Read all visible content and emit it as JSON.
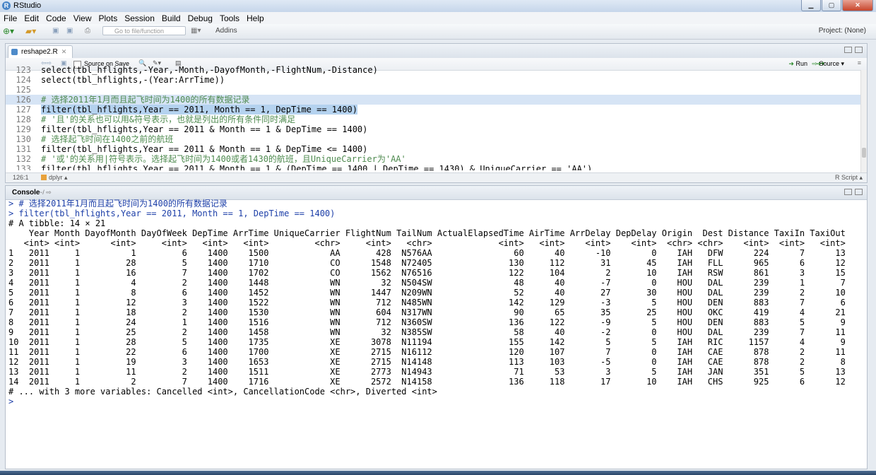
{
  "window": {
    "title": "RStudio"
  },
  "menu": [
    "File",
    "Edit",
    "Code",
    "View",
    "Plots",
    "Session",
    "Build",
    "Debug",
    "Tools",
    "Help"
  ],
  "toolbar": {
    "goto_placeholder": "Go to file/function",
    "addins": "Addins",
    "project": "Project: (None)"
  },
  "editor": {
    "tab_label": "reshape2.R",
    "source_on_save": "Source on Save",
    "run_label": "Run",
    "source_label": "Source",
    "cursor_pos": "126:1",
    "function_name": "dplyr",
    "file_type": "R Script",
    "lines": [
      {
        "n": "123",
        "text": "select(tbl_hflights,-Year,-Month,-DayofMonth,-FlightNum,-Distance)"
      },
      {
        "n": "124",
        "text": "select(tbl_hflights,-(Year:ArrTime))"
      },
      {
        "n": "125",
        "text": ""
      },
      {
        "n": "126",
        "text": "# 选择2011年1月而且起飞时间为1400的所有数据记录"
      },
      {
        "n": "127",
        "text": "filter(tbl_hflights,Year == 2011, Month == 1, DepTime == 1400)"
      },
      {
        "n": "128",
        "text": "# '且'的关系也可以用&符号表示，也就是列出的所有条件同时满足"
      },
      {
        "n": "129",
        "text": "filter(tbl_hflights,Year == 2011 & Month == 1 & DepTime == 1400)"
      },
      {
        "n": "130",
        "text": "# 选择起飞时间在1400之前的航班"
      },
      {
        "n": "131",
        "text": "filter(tbl_hflights,Year == 2011 & Month == 1 & DepTime <= 1400)"
      },
      {
        "n": "132",
        "text": "# '或'的关系用|符号表示。选择起飞时间为1400或者1430的航班，且UniqueCarrier为'AA'"
      },
      {
        "n": "133",
        "text": "filter(tbl_hflights,Year == 2011 & Month == 1 & (DepTime == 1400 | DepTime == 1430) & UniqueCarrier == 'AA')"
      }
    ]
  },
  "console": {
    "title": "Console",
    "path": "~/",
    "lines": [
      "> # 选择2011年1月而且起飞时间为1400的所有数据记录",
      "> filter(tbl_hflights,Year == 2011, Month == 1, DepTime == 1400)",
      "# A tibble: 14 × 21",
      "    Year Month DayofMonth DayOfWeek DepTime ArrTime UniqueCarrier FlightNum TailNum ActualElapsedTime AirTime ArrDelay DepDelay Origin  Dest Distance TaxiIn TaxiOut",
      "   <int> <int>      <int>     <int>   <int>   <int>         <chr>     <int>   <chr>             <int>   <int>    <int>    <int>  <chr> <chr>    <int>  <int>   <int>",
      "1   2011     1          1         6    1400    1500            AA       428  N576AA                60      40      -10        0    IAH   DFW      224      7      13",
      "2   2011     1         28         5    1400    1710            CO      1548  N72405               130     112       31       45    IAH   FLL      965      6      12",
      "3   2011     1         16         7    1400    1702            CO      1562  N76516               122     104        2       10    IAH   RSW      861      3      15",
      "4   2011     1          4         2    1400    1448            WN        32  N504SW                48      40       -7        0    HOU   DAL      239      1       7",
      "5   2011     1          8         6    1400    1452            WN      1447  N209WN                52      40       27       30    HOU   DAL      239      2      10",
      "6   2011     1         12         3    1400    1522            WN       712  N485WN               142     129       -3        5    HOU   DEN      883      7       6",
      "7   2011     1         18         2    1400    1530            WN       604  N317WN                90      65       35       25    HOU   OKC      419      4      21",
      "8   2011     1         24         1    1400    1516            WN       712  N360SW               136     122       -9        5    HOU   DEN      883      5       9",
      "9   2011     1         25         2    1400    1458            WN        32  N385SW                58      40       -2        0    HOU   DAL      239      7      11",
      "10  2011     1         28         5    1400    1735            XE      3078  N11194               155     142        5        5    IAH   RIC     1157      4       9",
      "11  2011     1         22         6    1400    1700            XE      2715  N16112               120     107        7        0    IAH   CAE      878      2      11",
      "12  2011     1         19         3    1400    1653            XE      2715  N14148               113     103       -5        0    IAH   CAE      878      2       8",
      "13  2011     1         11         2    1400    1511            XE      2773  N14943                71      53        3        5    IAH   JAN      351      5      13",
      "14  2011     1          2         7    1400    1716            XE      2572  N14158               136     118       17       10    IAH   CHS      925      6      12",
      "# ... with 3 more variables: Cancelled <int>, CancellationCode <chr>, Diverted <int>",
      "> "
    ]
  }
}
